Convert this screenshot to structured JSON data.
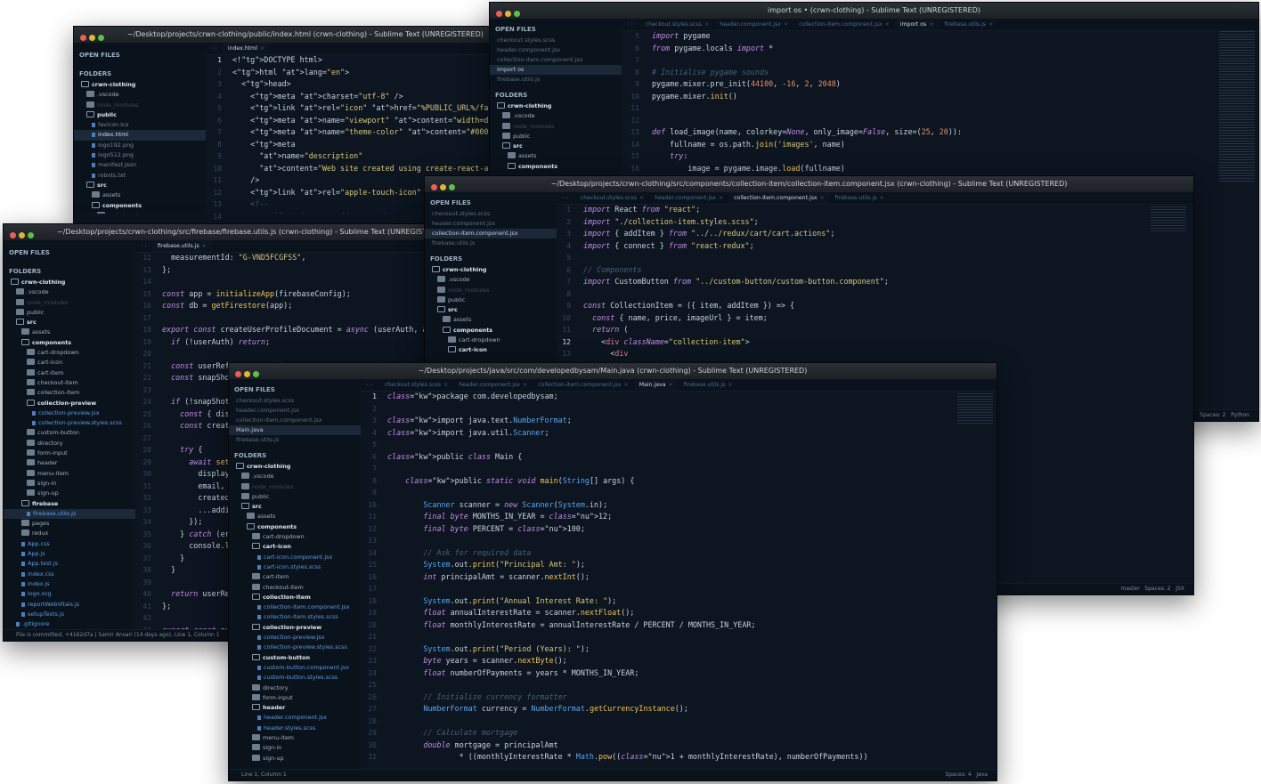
{
  "windows": {
    "index": {
      "title": "~/Desktop/projects/crwn-clothing/public/index.html (crwn-clothing) - Sublime Text (UNREGISTERED)",
      "open_files_label": "OPEN FILES",
      "folders_label": "FOLDERS",
      "tree": [
        "crwn-clothing",
        ".vscode",
        "node_modules",
        "public",
        "favicon.ico",
        "index.html",
        "logo192.png",
        "logo512.png",
        "manifest.json",
        "robots.txt",
        "src",
        "assets",
        "components",
        "cart-dropdown"
      ],
      "tab": "index.html",
      "line_numbers": [
        "1",
        "2",
        "3",
        "4",
        "5",
        "6",
        "7",
        "8",
        "9",
        "10",
        "11",
        "12",
        "13",
        "14"
      ]
    },
    "python": {
      "title": "import os • (crwn-clothing) - Sublime Text (UNREGISTERED)",
      "open_files": [
        "checkout.styles.scss",
        "header.component.jsx",
        "collection-item.component.jsx",
        "import os",
        "firebase.utils.js"
      ],
      "tree": [
        "crwn-clothing",
        ".vscode",
        "node_modules",
        "public",
        "src",
        "assets",
        "components"
      ],
      "tabs": [
        "checkout.styles.scss",
        "header.component.jsx",
        "collection-item.component.jsx",
        "import os",
        "firebase.utils.js"
      ],
      "line_numbers": [
        "5",
        "6",
        "7",
        "8",
        "9",
        "10",
        "11",
        "12",
        "13",
        "14",
        "15",
        "16"
      ],
      "status_right": [
        "Spaces: 2",
        "Python"
      ]
    },
    "firebase": {
      "title": "~/Desktop/projects/crwn-clothing/src/firebase/firebase.utils.js (crwn-clothing) - Sublime Text (UNREGISTERED)",
      "tree": [
        "crwn-clothing",
        ".vscode",
        "node_modules",
        "public",
        "src",
        "assets",
        "components",
        "cart-dropdown",
        "cart-icon",
        "cart-item",
        "checkout-item",
        "collection-item",
        "collection-preview",
        "collection-preview.jsx",
        "collection-preview.styles.scss",
        "custom-button",
        "directory",
        "form-input",
        "header",
        "menu-item",
        "sign-in",
        "sign-up",
        "firebase",
        "firebase.utils.js",
        "pages",
        "redux",
        "App.css",
        "App.js",
        "App.test.js",
        "index.css",
        "index.js",
        "logo.svg",
        "reportWebVitals.js",
        "setupTests.js",
        ".gitignore"
      ],
      "tab": "firebase.utils.js",
      "line_numbers": [
        "12",
        "13",
        "14",
        "15",
        "16",
        "17",
        "18",
        "19",
        "20",
        "21",
        "22",
        "23",
        "24",
        "25",
        "26",
        "27",
        "28",
        "29",
        "30",
        "31",
        "32",
        "33",
        "34",
        "35",
        "36",
        "37",
        "38",
        "39",
        "40",
        "41",
        "42",
        "43"
      ],
      "status_left": "File is committed, +4162d7a | Samir Ansari (14 days ago), Line 1, Column 1"
    },
    "jsx": {
      "title": "~/Desktop/projects/crwn-clothing/src/components/collection-item/collection-item.component.jsx (crwn-clothing) - Sublime Text (UNREGISTERED)",
      "open_files": [
        "checkout.styles.scss",
        "header.component.jsx",
        "collection-item.component.jsx",
        "firebase.utils.js"
      ],
      "tree": [
        "crwn-clothing",
        ".vscode",
        "node_modules",
        "public",
        "src",
        "assets",
        "components",
        "cart-dropdown",
        "cart-icon"
      ],
      "tabs": [
        "checkout.styles.scss",
        "header.component.jsx",
        "collection-item.component.jsx",
        "firebase.utils.js"
      ],
      "line_numbers": [
        "1",
        "2",
        "3",
        "4",
        "5",
        "6",
        "7",
        "8",
        "9",
        "10",
        "11",
        "12",
        "13"
      ],
      "status_right": [
        "master",
        "Spaces: 2",
        "JSX"
      ]
    },
    "java": {
      "title": "~/Desktop/projects/java/src/com/developedbysam/Main.java (crwn-clothing) - Sublime Text (UNREGISTERED)",
      "open_files": [
        "checkout.styles.scss",
        "header.component.jsx",
        "collection-item.component.jsx",
        "Main.java",
        "firebase.utils.js"
      ],
      "tree": [
        "crwn-clothing",
        ".vscode",
        "node_modules",
        "public",
        "src",
        "assets",
        "components",
        "cart-dropdown",
        "cart-icon",
        "cart-icon.component.jsx",
        "cart-icon.styles.scss",
        "cart-item",
        "checkout-item",
        "collection-item",
        "collection-item.component.jsx",
        "collection-item.styles.scss",
        "collection-preview",
        "collection-preview.jsx",
        "collection-preview.styles.scss",
        "custom-button",
        "custom-button.component.jsx",
        "custom-button.styles.scss",
        "directory",
        "form-input",
        "header",
        "header.component.jsx",
        "header.styles.scss",
        "menu-item",
        "sign-in",
        "sign-up"
      ],
      "tabs": [
        "checkout.styles.scss",
        "header.component.jsx",
        "collection-item.component.jsx",
        "Main.java",
        "firebase.utils.js"
      ],
      "line_numbers": [
        "1",
        "2",
        "3",
        "4",
        "5",
        "6",
        "7",
        "8",
        "9",
        "10",
        "11",
        "12",
        "13",
        "14",
        "15",
        "16",
        "17",
        "18",
        "19",
        "20",
        "21",
        "22",
        "23",
        "24",
        "25",
        "26",
        "27",
        "28",
        "29",
        "30",
        "31"
      ],
      "status_left": "Line 1, Column 1",
      "status_right": [
        "Spaces: 4",
        "Java"
      ]
    }
  },
  "code": {
    "index": [
      "<!DOCTYPE html>",
      "<html lang=\"en\">",
      "  <head>",
      "    <meta charset=\"utf-8\" />",
      "    <link rel=\"icon\" href=\"%PUBLIC_URL%/favicon.ico\" />",
      "    <meta name=\"viewport\" content=\"width=device-width, initial-scale=1\" />",
      "    <meta name=\"theme-color\" content=\"#000000\" />",
      "    <meta",
      "      name=\"description\"",
      "      content=\"Web site created using create-react-app\"",
      "    />",
      "    <link rel=\"apple-touch-icon\" href=\"%PUBLIC_URL%/logo192.png\" />",
      "    <!--",
      "      manifest.json provides metadata used when your web app is installed"
    ],
    "python": [
      "import pygame",
      "from pygame.locals import *",
      "",
      "# Initialise pygame sounds",
      "pygame.mixer.pre_init(44100, -16, 2, 2048)",
      "pygame.mixer.init()",
      "",
      "",
      "def load_image(name, colorkey=None, only_image=False, size=(25, 20)):",
      "    fullname = os.path.join('images', name)",
      "    try:",
      "        image = pygame.image.load(fullname)"
    ],
    "firebase": [
      "  measurementId: \"G-VND5FCGFSS\",",
      "};",
      "",
      "const app = initializeApp(firebaseConfig);",
      "const db = getFirestore(app);",
      "",
      "export const createUserProfileDocument = async (userAuth, additionalData) => {",
      "  if (!userAuth) return;",
      "",
      "  const userRef = doc(db, `users/${userAuth.uid}`);",
      "  const snapShot = await getDoc(userRef);",
      "",
      "  if (!snapShot.exists()) {",
      "    const { displayName, email } = userAuth;",
      "    const createdAt = new Date();",
      "",
      "    try {",
      "      await setDoc(userRef, {",
      "        displayName,",
      "        email,",
      "        createdAt,",
      "        ...additionalData,",
      "      });",
      "    } catch (error) {",
      "      console.log('error creating user', error.message);",
      "    }",
      "  }",
      "",
      "  return userRef;",
      "};",
      "",
      "export const auth = getAuth(app);"
    ],
    "jsx": [
      "import React from \"react\";",
      "import \"./collection-item.styles.scss\";",
      "import { addItem } from \"../../redux/cart/cart.actions\";",
      "import { connect } from \"react-redux\";",
      "",
      "// Components",
      "import CustomButton from \"../custom-button/custom-button.component\";",
      "",
      "const CollectionItem = ({ item, addItem }) => {",
      "  const { name, price, imageUrl } = item;",
      "  return (",
      "    <div className=\"collection-item\">",
      "      <div"
    ],
    "java": [
      "package com.developedbysam;",
      "",
      "import java.text.NumberFormat;",
      "import java.util.Scanner;",
      "",
      "public class Main {",
      "",
      "    public static void main(String[] args) {",
      "",
      "        Scanner scanner = new Scanner(System.in);",
      "        final byte MONTHS_IN_YEAR = 12;",
      "        final byte PERCENT = 100;",
      "",
      "        // Ask for required data",
      "        System.out.print(\"Principal Amt: \");",
      "        int principalAmt = scanner.nextInt();",
      "",
      "        System.out.print(\"Annual Interest Rate: \");",
      "        float annualInterestRate = scanner.nextFloat();",
      "        float monthlyInterestRate = annualInterestRate / PERCENT / MONTHS_IN_YEAR;",
      "",
      "        System.out.print(\"Period (Years): \");",
      "        byte years = scanner.nextByte();",
      "        float numberOfPayments = years * MONTHS_IN_YEAR;",
      "",
      "        // Initialize currency formatter",
      "        NumberFormat currency = NumberFormat.getCurrencyInstance();",
      "",
      "        // Calculate mortgage",
      "        double mortgage = principalAmt",
      "                * ((monthlyInterestRate * Math.pow((1 + monthlyInterestRate), numberOfPayments))"
    ]
  }
}
